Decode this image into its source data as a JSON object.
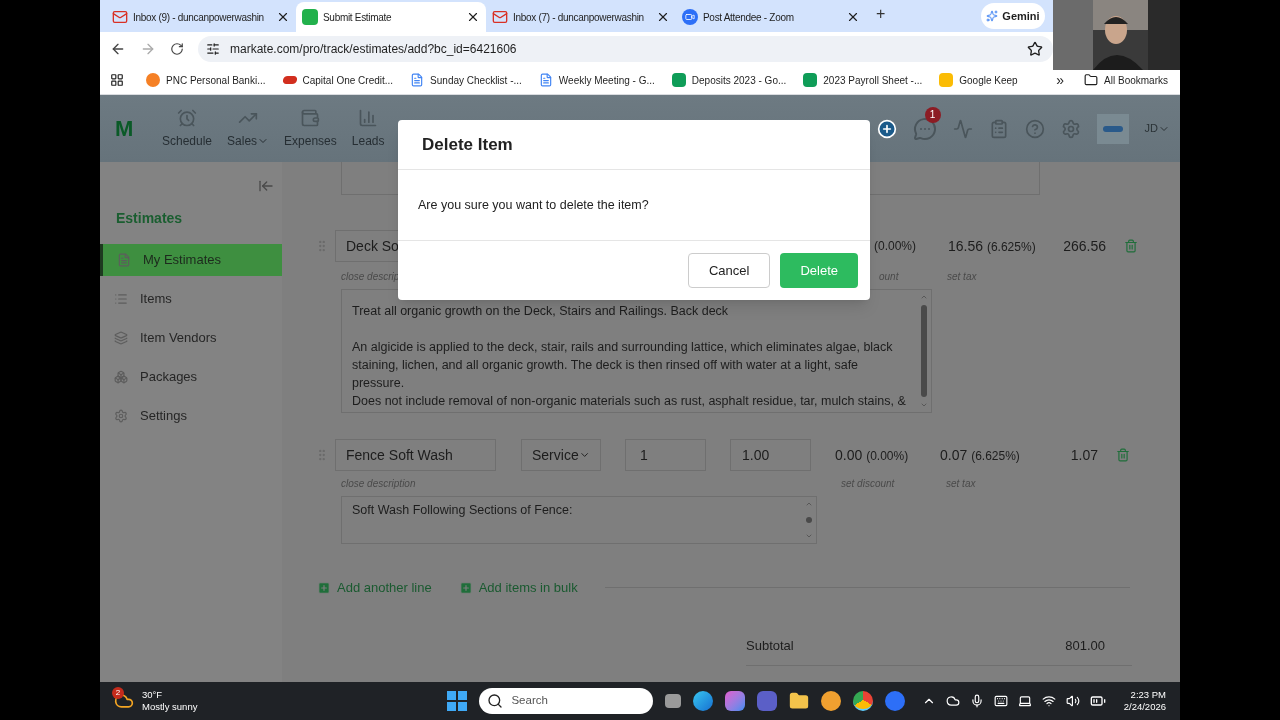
{
  "browser": {
    "tabs": [
      {
        "title": "Inbox (9) - duncanpowerwashin",
        "kind": "mail",
        "selected": false
      },
      {
        "title": "Submit Estimate",
        "kind": "app",
        "selected": true
      },
      {
        "title": "Inbox (7) - duncanpowerwashin",
        "kind": "mail",
        "selected": false
      },
      {
        "title": "Post Attendee - Zoom",
        "kind": "video",
        "selected": false
      }
    ],
    "new_tab": "+",
    "assistant": "Gemini",
    "url": "markate.com/pro/track/estimates/add?bc_id=6421606",
    "bookmarks": [
      {
        "label": "PNC Personal Banki...",
        "kind": "bank"
      },
      {
        "label": "Capital One Credit...",
        "kind": "card"
      },
      {
        "label": "Sunday Checklist -...",
        "kind": "doc"
      },
      {
        "label": "Weekly Meeting - G...",
        "kind": "doc"
      },
      {
        "label": "Deposits 2023 - Go...",
        "kind": "sheet"
      },
      {
        "label": "2023 Payroll Sheet -...",
        "kind": "sheet"
      },
      {
        "label": "Google Keep",
        "kind": "note"
      }
    ],
    "more_bookmarks": "»",
    "all_bookmarks": "All Bookmarks"
  },
  "app": {
    "logo": "M",
    "nav": [
      {
        "label": "Schedule",
        "dropdown": false
      },
      {
        "label": "Sales",
        "dropdown": true
      },
      {
        "label": "Expenses",
        "dropdown": false
      },
      {
        "label": "Leads",
        "dropdown": false
      }
    ],
    "messages_badge": "1",
    "user": "JD",
    "sidebar": {
      "title": "Estimates",
      "items": [
        {
          "label": "My Estimates",
          "selected": true
        },
        {
          "label": "Items",
          "selected": false
        },
        {
          "label": "Item Vendors",
          "selected": false
        },
        {
          "label": "Packages",
          "selected": false
        },
        {
          "label": "Settings",
          "selected": false
        }
      ]
    },
    "line_items": [
      {
        "name": "Deck So",
        "discount_pct": "(0.00%)",
        "tax": "16.56",
        "tax_pct": "(6.625%)",
        "total": "266.56",
        "description_label": "close descrip",
        "discount_label": "ount",
        "tax_label": "set tax",
        "description": [
          {
            "text": "Treat all organic growth on the Deck, Stairs and Railings. Back deck",
            "blank_before": false
          },
          {
            "text": "An algicide is applied to the deck, stair, rails and surrounding lattice, which eliminates algae, black staining, lichen, and all organic growth. The deck is then rinsed off with water at a light, safe pressure.",
            "blank_before": true
          },
          {
            "text": "Does not include removal of non-organic materials such as rust, asphalt residue, tar, mulch stains, &",
            "blank_before": false
          }
        ]
      },
      {
        "name": "Fence Soft Wash",
        "type": "Service",
        "qty": "1",
        "price": "1.00",
        "discount": "0.00",
        "discount_pct": "(0.00%)",
        "tax": "0.07",
        "tax_pct": "(6.625%)",
        "total": "1.07",
        "description_label": "close description",
        "discount_label": "set discount",
        "tax_label": "set tax",
        "description": [
          {
            "text": "Soft Wash Following Sections of Fence:",
            "blank_before": false
          }
        ]
      }
    ],
    "links": [
      "Add another line",
      "Add items in bulk"
    ],
    "subtotal": {
      "label": "Subtotal",
      "value": "801.00"
    }
  },
  "dialog": {
    "title": "Delete Item",
    "message": "Are you sure you want to delete the item?",
    "buttons": [
      {
        "label": "Cancel",
        "kind": "secondary"
      },
      {
        "label": "Delete",
        "kind": "primary"
      }
    ]
  },
  "taskbar": {
    "weather": {
      "badge": "2",
      "temperature": "30°F",
      "condition": "Mostly sunny"
    },
    "search_placeholder": "Search",
    "time": "2:23 PM",
    "date": "2/24/2026"
  }
}
